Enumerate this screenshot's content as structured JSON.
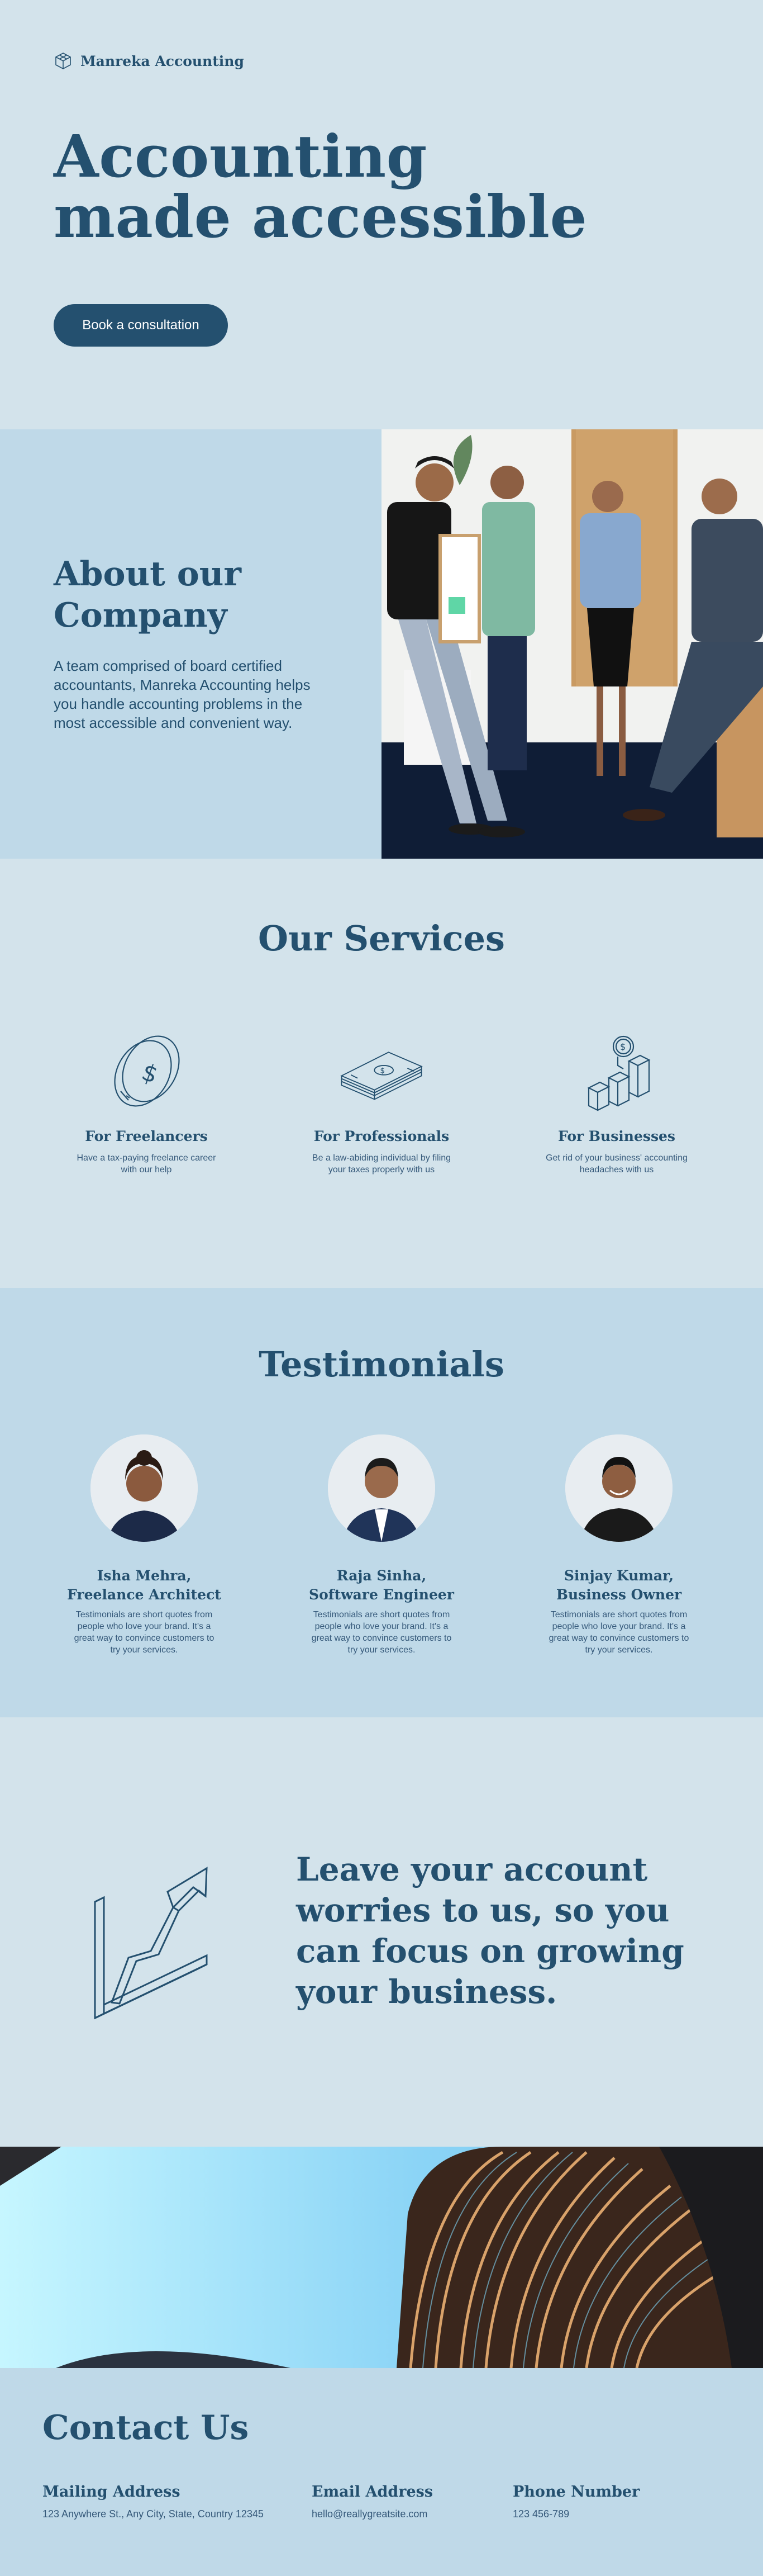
{
  "brand": {
    "name": "Manreka Accounting",
    "icon": "cube-icon"
  },
  "hero": {
    "title_line1": "Accounting",
    "title_line2": "made accessible",
    "cta_label": "Book a consultation"
  },
  "about": {
    "title_line1": "About our",
    "title_line2": "Company",
    "text": "A team comprised of board certified accountants, Manreka Accounting helps you handle accounting problems in the most accessible and convenient way."
  },
  "services": {
    "title": "Our Services",
    "items": [
      {
        "title": "For Freelancers",
        "text": "Have a tax-paying freelance career with our help",
        "icon": "coin-icon"
      },
      {
        "title": "For Professionals",
        "text": "Be a law-abiding individual by filing your taxes properly with us",
        "icon": "money-stack-icon"
      },
      {
        "title": "For Businesses",
        "text": "Get rid of your business' accounting headaches with us",
        "icon": "bar-chart-coin-icon"
      }
    ]
  },
  "testimonials": {
    "title": "Testimonials",
    "items": [
      {
        "name": "Isha Mehra,",
        "role": "Freelance Architect",
        "text": "Testimonials are short quotes from people who love your brand. It's a great way to convince customers to try your services."
      },
      {
        "name": "Raja Sinha,",
        "role": "Software Engineer",
        "text": "Testimonials are short quotes from people who love your brand. It's a great way to convince customers to try your services."
      },
      {
        "name": "Sinjay Kumar,",
        "role": "Business Owner",
        "text": "Testimonials are short quotes from people who love your brand. It's a great way to convince customers to try your services."
      }
    ]
  },
  "growth": {
    "text": "Leave your account worries to us, so you can focus on growing your business.",
    "icon": "growth-arrow-icon"
  },
  "contact": {
    "title": "Contact Us",
    "mailing_label": "Mailing Address",
    "mailing_value": "123 Anywhere St., Any City, State, Country 12345",
    "email_label": "Email Address",
    "email_value": "hello@reallygreatsite.com",
    "phone_label": "Phone Number",
    "phone_value": "123 456-789"
  },
  "colors": {
    "navy": "#24506f",
    "light": "#d3e3eb",
    "mid": "#bfd9e8"
  }
}
